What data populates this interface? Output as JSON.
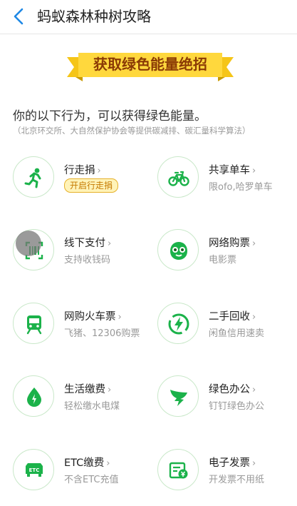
{
  "nav": {
    "title": "蚂蚁森林种树攻略"
  },
  "banner": {
    "text": "获取绿色能量绝招"
  },
  "intro": {
    "headline": "你的以下行为，可以获得绿色能量。",
    "note": "（北京环交所、大自然保护协会等提供碳减排、碳汇量科学算法）"
  },
  "items": [
    {
      "label": "行走捐",
      "pill": "开启行走捐",
      "icon": "running-person-icon"
    },
    {
      "label": "共享单车",
      "sub": "限ofo,哈罗单车",
      "icon": "bicycle-icon"
    },
    {
      "label": "线下支付",
      "sub": "支持收钱码",
      "icon": "barcode-icon"
    },
    {
      "label": "网络购票",
      "sub": "电影票",
      "icon": "cinema-mascot-icon"
    },
    {
      "label": "网购火车票",
      "sub": "飞猪、12306购票",
      "icon": "train-icon"
    },
    {
      "label": "二手回收",
      "sub": "闲鱼信用速卖",
      "icon": "lightning-recycle-icon"
    },
    {
      "label": "生活缴费",
      "sub": "轻松缴水电煤",
      "icon": "water-drop-icon"
    },
    {
      "label": "绿色办公",
      "sub": "钉钉绿色办公",
      "icon": "dingtalk-icon"
    },
    {
      "label": "ETC缴费",
      "sub": "不含ETC充值",
      "icon": "etc-icon"
    },
    {
      "label": "电子发票",
      "sub": "开发票不用纸",
      "icon": "e-invoice-icon"
    }
  ],
  "colors": {
    "green": "#1bb24a",
    "banner_yellow": "#ffd83d",
    "banner_text": "#8a3a05"
  }
}
